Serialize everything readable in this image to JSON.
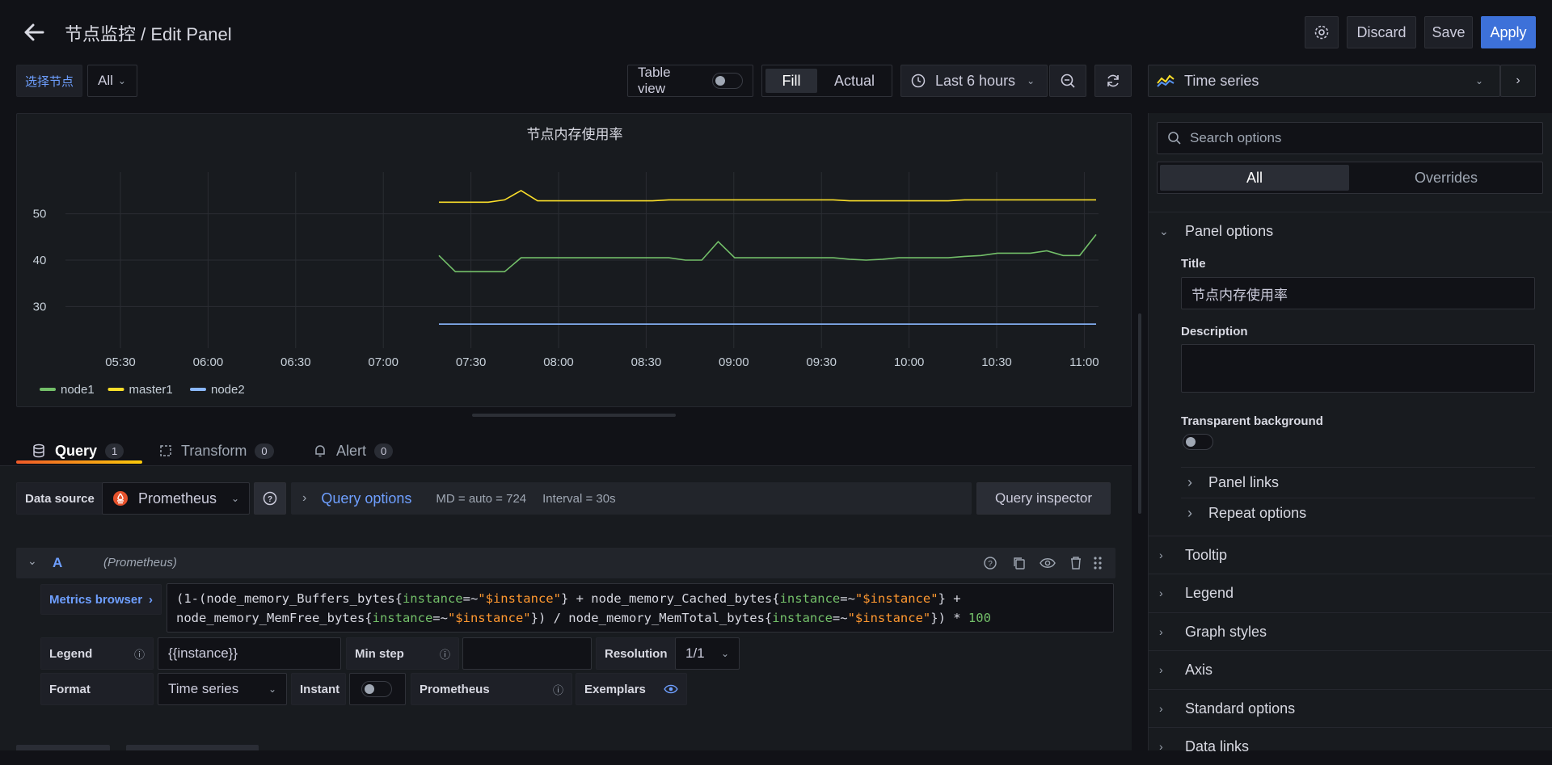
{
  "header": {
    "title": "节点监控 / Edit Panel",
    "discard": "Discard",
    "save": "Save",
    "apply": "Apply"
  },
  "toolbar": {
    "var_label": "选择节点",
    "var_value": "All",
    "table_view": "Table view",
    "fill": "Fill",
    "actual": "Actual",
    "time_range": "Last 6 hours"
  },
  "viz_picker": {
    "value": "Time series"
  },
  "chart_data": {
    "type": "line",
    "title": "节点内存使用率",
    "x_ticks": [
      "05:30",
      "06:00",
      "06:30",
      "07:00",
      "07:30",
      "08:00",
      "08:30",
      "09:00",
      "09:30",
      "10:00",
      "10:30",
      "11:00"
    ],
    "y_ticks": [
      "50",
      "40",
      "30"
    ],
    "ylim": [
      21,
      59
    ],
    "x": [
      0,
      1,
      2,
      3,
      4,
      5,
      6,
      7,
      8,
      9,
      10,
      11,
      12,
      13,
      14,
      15,
      16,
      17,
      18,
      19,
      20,
      21,
      22,
      23,
      24,
      25,
      26,
      27,
      28,
      29,
      30,
      31,
      32,
      33,
      34,
      35,
      36,
      37,
      38,
      39,
      40
    ],
    "x_labels_note": "",
    "series": [
      {
        "name": "node1",
        "color": "#73bf69",
        "values": [
          41,
          37.5,
          37.5,
          37.5,
          37.5,
          40.5,
          40.5,
          40.5,
          40.5,
          40.5,
          40.5,
          40.5,
          40.5,
          40.5,
          40.5,
          40,
          40,
          44,
          40.5,
          40.5,
          40.5,
          40.5,
          40.5,
          40.5,
          40.5,
          40.2,
          40,
          40.2,
          40.5,
          40.5,
          40.5,
          40.5,
          40.8,
          41,
          41.5,
          41.5,
          41.5,
          42,
          41,
          41,
          45.5
        ]
      },
      {
        "name": "master1",
        "color": "#fade2a",
        "values": [
          52.5,
          52.5,
          52.5,
          52.5,
          53,
          55,
          52.8,
          52.8,
          52.8,
          52.8,
          52.8,
          52.8,
          52.8,
          52.8,
          53,
          53,
          53,
          53,
          53,
          53,
          53,
          53,
          53,
          53,
          53,
          52.8,
          52.8,
          52.8,
          52.8,
          52.8,
          52.8,
          52.8,
          53,
          53,
          53,
          53,
          53,
          53,
          53,
          53,
          53
        ]
      },
      {
        "name": "node2",
        "color": "#8ab8ff",
        "values": [
          26.2,
          26.2,
          26.2,
          26.2,
          26.2,
          26.2,
          26.2,
          26.2,
          26.2,
          26.2,
          26.2,
          26.2,
          26.2,
          26.2,
          26.2,
          26.2,
          26.2,
          26.2,
          26.2,
          26.2,
          26.2,
          26.2,
          26.2,
          26.2,
          26.2,
          26.2,
          26.2,
          26.2,
          26.2,
          26.2,
          26.2,
          26.2,
          26.2,
          26.2,
          26.2,
          26.2,
          26.2,
          26.2,
          26.2,
          26.2,
          26.2
        ]
      }
    ],
    "legend": [
      "node1",
      "master1",
      "node2"
    ],
    "legend_position": "bottom-left",
    "grid": true
  },
  "query_tabs": {
    "query": "Query",
    "query_count": "1",
    "transform": "Transform",
    "transform_count": "0",
    "alert": "Alert",
    "alert_count": "0"
  },
  "datasource": {
    "label": "Data source",
    "value": "Prometheus",
    "options_label": "Query options",
    "md": "MD = auto = 724",
    "interval": "Interval = 30s",
    "inspector": "Query inspector"
  },
  "query_row": {
    "ref": "A",
    "ds_hint": "(Prometheus)",
    "metrics_browser": "Metrics browser",
    "expr_line1_a": "(1-(node_memory_Buffers_bytes{",
    "expr_key": "instance",
    "expr_op": "=~",
    "expr_val": "\"$instance\"",
    "expr_line1_b": "} + node_memory_Cached_bytes{",
    "expr_line1_c": "} +",
    "expr_line2_a": "node_memory_MemFree_bytes{",
    "expr_line2_b": "}) / node_memory_MemTotal_bytes{",
    "expr_line2_c": "}) * ",
    "expr_num": "100",
    "legend_label": "Legend",
    "legend_value": "{{instance}}",
    "min_step_label": "Min step",
    "resolution_label": "Resolution",
    "resolution_value": "1/1",
    "format_label": "Format",
    "format_value": "Time series",
    "instant_label": "Instant",
    "prom_label": "Prometheus",
    "exemplars_label": "Exemplars"
  },
  "options_pane": {
    "search_placeholder": "Search options",
    "tab_all": "All",
    "tab_overrides": "Overrides",
    "panel_options": "Panel options",
    "title_label": "Title",
    "title_value": "节点内存使用率",
    "description_label": "Description",
    "transparent_label": "Transparent background",
    "panel_links": "Panel links",
    "repeat_options": "Repeat options",
    "sections": [
      "Tooltip",
      "Legend",
      "Graph styles",
      "Axis",
      "Standard options",
      "Data links"
    ]
  },
  "colors": {
    "accent": "#3d71d9",
    "link": "#6e9fff",
    "orange": "#f05a28"
  }
}
